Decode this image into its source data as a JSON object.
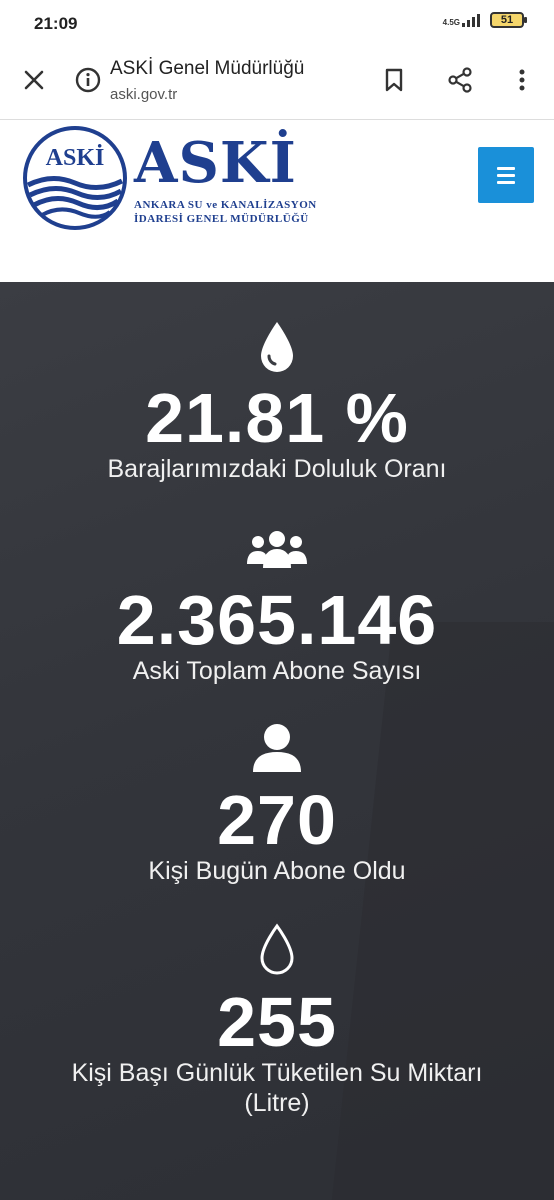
{
  "status": {
    "time": "21:09",
    "network": "4.5G",
    "battery": "51"
  },
  "browser": {
    "title": "ASKİ Genel Müdürlüğü",
    "url": "aski.gov.tr",
    "icons": [
      "close-icon",
      "info-icon",
      "bookmark-icon",
      "share-icon",
      "more-vert-icon"
    ]
  },
  "site": {
    "logo_badge_text": "ASKİ",
    "logo_word": "ASKİ",
    "logo_line1": "ANKARA SU ve KANALİZASYON",
    "logo_line2": "İDARESİ GENEL MÜDÜRLÜĞÜ",
    "brand_color": "#1f3f8f",
    "menu_color": "#1a90d9"
  },
  "stats": [
    {
      "icon": "water-drop-icon",
      "value": "21.81 %",
      "label": "Barajlarımızdaki Doluluk Oranı"
    },
    {
      "icon": "users-group-icon",
      "value": "2.365.146",
      "label": "Aski Toplam Abone Sayısı"
    },
    {
      "icon": "user-icon",
      "value": "270",
      "label": "Kişi Bugün Abone Oldu"
    },
    {
      "icon": "water-drop-outline-icon",
      "value": "255",
      "label": "Kişi Başı Günlük Tüketilen Su Miktarı (Litre)"
    }
  ]
}
